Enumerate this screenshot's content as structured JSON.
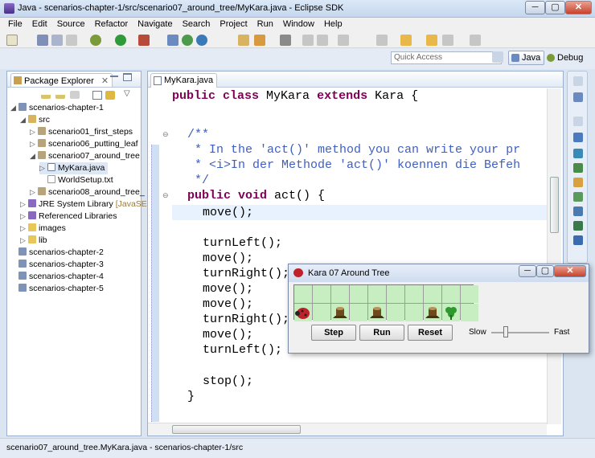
{
  "window": {
    "title": "Java - scenarios-chapter-1/src/scenario07_around_tree/MyKara.java - Eclipse SDK"
  },
  "menu": [
    "File",
    "Edit",
    "Source",
    "Refactor",
    "Navigate",
    "Search",
    "Project",
    "Run",
    "Window",
    "Help"
  ],
  "quick_access": {
    "placeholder": "Quick Access"
  },
  "perspectives": {
    "java": "Java",
    "debug": "Debug"
  },
  "package_explorer": {
    "tab": "Package Explorer",
    "rows": [
      {
        "label": "scenarios-chapter-1",
        "suffix": ""
      },
      {
        "label": "src",
        "suffix": ""
      },
      {
        "label": "scenario01_first_steps",
        "suffix": ""
      },
      {
        "label": "scenario06_putting_leaf",
        "suffix": ""
      },
      {
        "label": "scenario07_around_tree",
        "suffix": ""
      },
      {
        "label": "MyKara.java",
        "suffix": ""
      },
      {
        "label": "WorldSetup.txt",
        "suffix": ""
      },
      {
        "label": "scenario08_around_tree_",
        "suffix": ""
      },
      {
        "label": "JRE System Library",
        "suffix": "[JavaSE-1"
      },
      {
        "label": "Referenced Libraries",
        "suffix": ""
      },
      {
        "label": "images",
        "suffix": ""
      },
      {
        "label": "lib",
        "suffix": ""
      },
      {
        "label": "scenarios-chapter-2",
        "suffix": ""
      },
      {
        "label": "scenarios-chapter-3",
        "suffix": ""
      },
      {
        "label": "scenarios-chapter-4",
        "suffix": ""
      },
      {
        "label": "scenarios-chapter-5",
        "suffix": ""
      }
    ]
  },
  "editor": {
    "tab": "MyKara.java",
    "lines": [
      [
        "public",
        " ",
        "class",
        " MyKara ",
        "extends",
        " Kara {"
      ],
      [
        "/**"
      ],
      [
        " * In the 'act()' method you can write your pr"
      ],
      [
        " * <i>In der Methode 'act()' koennen die Befeh"
      ],
      [
        " */"
      ],
      [
        "public",
        " ",
        "void",
        " act() {"
      ],
      [
        "move();"
      ],
      [
        "turnLeft();"
      ],
      [
        "move();"
      ],
      [
        "turnRight();"
      ],
      [
        "move();"
      ],
      [
        "move();"
      ],
      [
        "turnRight();"
      ],
      [
        "move();"
      ],
      [
        "turnLeft();"
      ],
      [
        "stop();"
      ],
      [
        "}"
      ]
    ]
  },
  "kara": {
    "title": "Kara 07 Around Tree",
    "buttons": {
      "step": "Step",
      "run": "Run",
      "reset": "Reset"
    },
    "speed": {
      "slow": "Slow",
      "fast": "Fast",
      "level": 0.25
    },
    "colors": {
      "grass": "#c7eec0",
      "bug": "#c0202a",
      "tree": "#6b4a1e",
      "leaf": "#2e9a2e"
    }
  },
  "status": {
    "text": "scenario07_around_tree.MyKara.java - scenarios-chapter-1/src"
  }
}
